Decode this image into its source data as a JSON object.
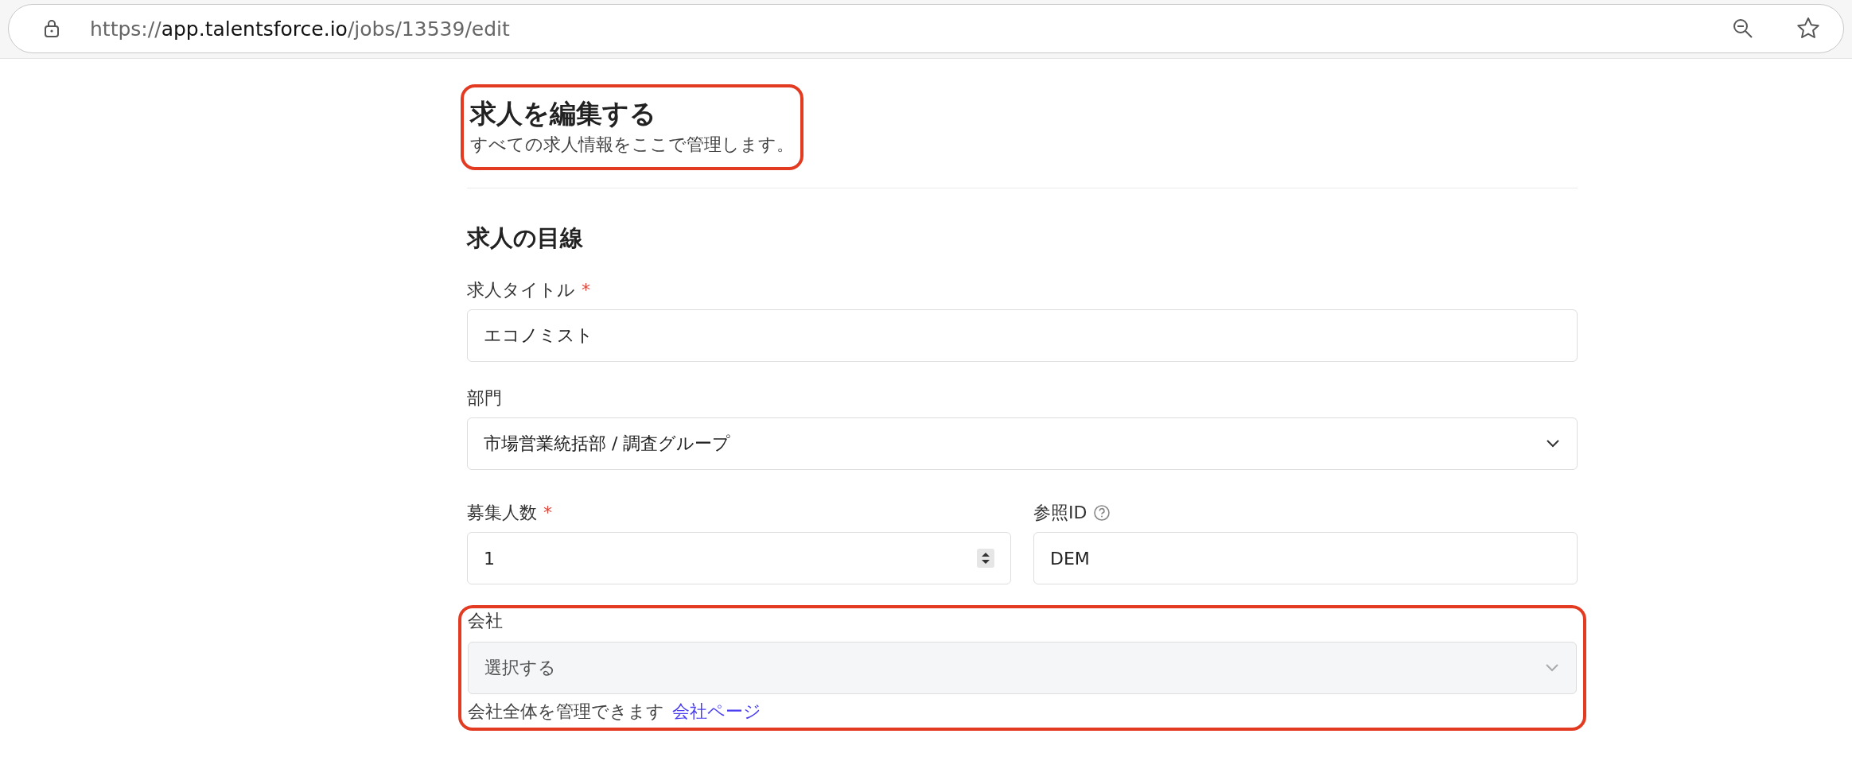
{
  "browser": {
    "url": {
      "scheme": "https://",
      "host": "app.talentsforce.io",
      "path": "/jobs/13539/edit"
    }
  },
  "header": {
    "title": "求人を編集する",
    "subtitle": "すべての求人情報をここで管理します。",
    "highlighted": true
  },
  "section": {
    "title": "求人の目線"
  },
  "fields": [
    {
      "kind": "text",
      "label": "求人タイトル",
      "required_mark": "*",
      "value": "エコノミスト"
    },
    {
      "kind": "select",
      "label": "部門",
      "value": "市場営業統括部 / 調査グループ"
    }
  ],
  "row_fields": [
    {
      "kind": "number",
      "label": "募集人数",
      "required_mark": "*",
      "value": "1"
    },
    {
      "kind": "text",
      "label": "参照ID",
      "help_icon": true,
      "value": "DEM"
    }
  ],
  "company": {
    "label": "会社",
    "placeholder": "選択する",
    "disabled": true,
    "hint": "会社全体を管理できます",
    "link": "会社ページ",
    "highlighted": true
  }
}
